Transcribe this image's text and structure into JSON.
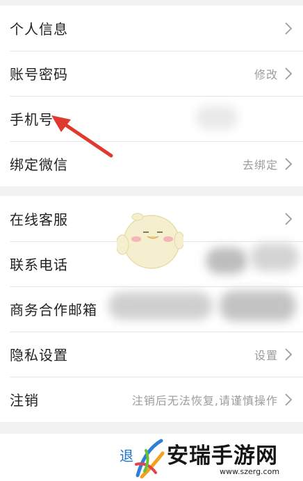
{
  "group1": {
    "items": [
      {
        "label": "个人信息",
        "value": ""
      },
      {
        "label": "账号密码",
        "value": "修改"
      },
      {
        "label": "手机号",
        "value": ""
      },
      {
        "label": "绑定微信",
        "value": "去绑定"
      }
    ]
  },
  "group2": {
    "items": [
      {
        "label": "在线客服",
        "value": ""
      },
      {
        "label": "联系电话",
        "value": ""
      },
      {
        "label": "商务合作邮箱",
        "value": ""
      },
      {
        "label": "隐私设置",
        "value": "设置"
      },
      {
        "label": "注销",
        "value": "注销后无法恢复,请谨慎操作"
      }
    ]
  },
  "logout": {
    "label": "退"
  },
  "watermark": {
    "name": "安瑞手游网",
    "url": "www.szerg.com"
  },
  "colors": {
    "background": "#f2f2f2",
    "arrow": "#e03a2f",
    "logout": "#1a73c9",
    "muted": "#9c9c9c"
  }
}
